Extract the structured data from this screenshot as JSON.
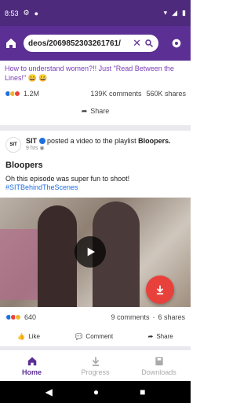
{
  "status_bar": {
    "time": "8:53"
  },
  "browser": {
    "url": "deos/2069852303261761/"
  },
  "post1": {
    "text": "How to understand women?!! Just \"Read Between the Lines!\" 😄 😀",
    "reactions_count": "1.2M",
    "comments": "139K comments",
    "shares": "560K shares",
    "share_label": "Share"
  },
  "post2": {
    "author": "SIT",
    "action": "posted a video to the playlist",
    "playlist": "Bloopers.",
    "time": "9 hrs",
    "title": "Bloopers",
    "description": "Oh this episode was super fun to shoot!",
    "hashtag": "#SITBehindTheScenes",
    "reactions_count": "640",
    "comments": "9 comments",
    "shares": "6 shares",
    "actions": {
      "like": "Like",
      "comment": "Comment",
      "share": "Share"
    }
  },
  "bottom_nav": {
    "home": "Home",
    "progress": "Progress",
    "downloads": "Downloads"
  },
  "colors": {
    "primary": "#5c2f94",
    "accent": "#e8413c",
    "link": "#1f6fe0"
  }
}
